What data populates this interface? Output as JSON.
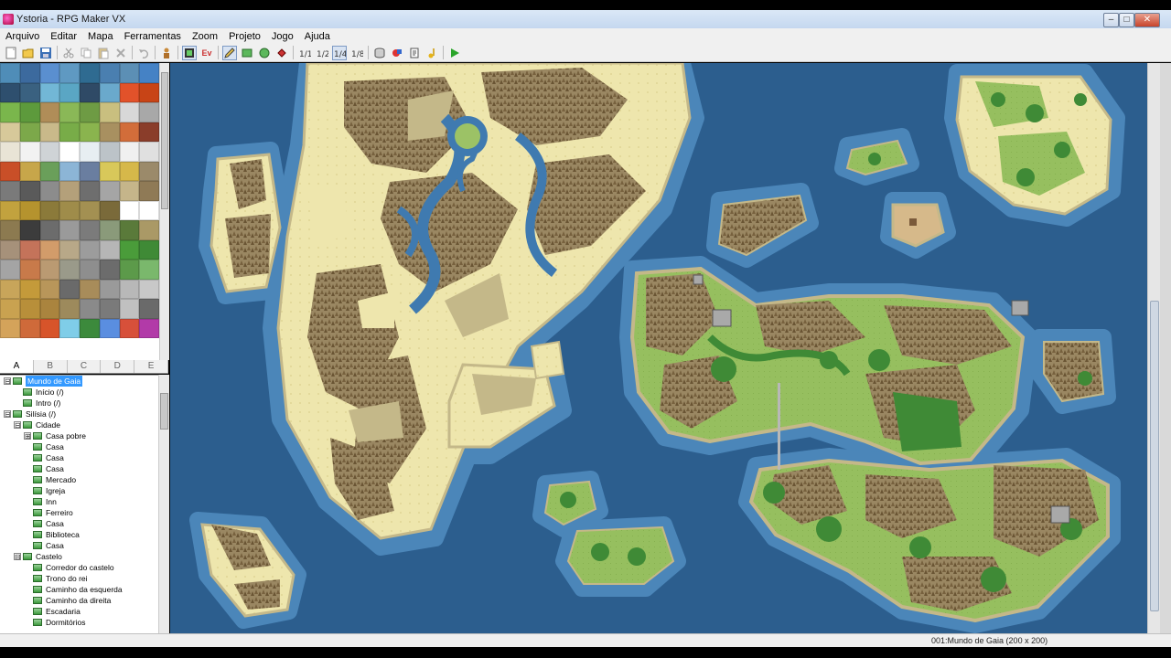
{
  "window": {
    "title": "Ystoria - RPG Maker VX",
    "minimize_label": "–",
    "maximize_label": "□",
    "close_label": "✕"
  },
  "menu": [
    "Arquivo",
    "Editar",
    "Mapa",
    "Ferramentas",
    "Zoom",
    "Projeto",
    "Jogo",
    "Ajuda"
  ],
  "toolbar": {
    "icons": [
      "new-project-icon",
      "open-project-icon",
      "save-icon",
      "cut-icon",
      "copy-icon",
      "paste-icon",
      "delete-icon",
      "undo-icon",
      "character-icon",
      "layer-map-icon",
      "layer-event-icon",
      "pencil-icon",
      "rectangle-icon",
      "ellipse-icon",
      "fill-icon",
      "zoom-1-1-icon",
      "zoom-1-2-icon",
      "zoom-1-4-icon",
      "zoom-1-8-icon",
      "database-icon",
      "material-icon",
      "script-editor-icon",
      "sound-test-icon",
      "playtest-icon"
    ],
    "event_layer_text": "Ev"
  },
  "tileset": {
    "tabs": [
      "A",
      "B",
      "C",
      "D",
      "E"
    ],
    "active_tab": "A",
    "tile_colors": [
      "#4f8db8",
      "#3c6a9e",
      "#5a8fd0",
      "#5f99c2",
      "#2f6b91",
      "#4a7fb0",
      "#5c8fb5",
      "#4582c5",
      "#2e4f6e",
      "#3a6180",
      "#72b7d6",
      "#5aa6c4",
      "#2f4a66",
      "#6aa9cc",
      "#e2522a",
      "#c84416",
      "#7ab64c",
      "#5d9a3c",
      "#b08d58",
      "#8ab857",
      "#6e9b44",
      "#c9bf7f",
      "#d8d8d8",
      "#a8a8a8",
      "#d7c99a",
      "#7ca84a",
      "#c9b98a",
      "#78ac48",
      "#8ab44e",
      "#a89060",
      "#d26d3a",
      "#8a3d2a",
      "#e9e4d6",
      "#f2f2f2",
      "#cfd3d6",
      "#ffffff",
      "#e7eef2",
      "#bcc3c8",
      "#f0f0f0",
      "#e0e0e0",
      "#c94f28",
      "#c7a64a",
      "#6a9f5a",
      "#8cb5d6",
      "#6a7ea0",
      "#d8c85a",
      "#d6b84a",
      "#9b8a6a",
      "#7a7a7a",
      "#5a5a5a",
      "#8c8c8c",
      "#b4a07a",
      "#6e6e6e",
      "#a5a5a5",
      "#c5b58a",
      "#8f7a56",
      "#c2a23e",
      "#b5932e",
      "#8b7a3a",
      "#9f8c4a",
      "#a39052",
      "#7a6a3a",
      "#ffffff",
      "#ffffff",
      "#8c7a50",
      "#3c3c3c",
      "#6c6c6c",
      "#9a9a9a",
      "#7b7b7b",
      "#8a9a7a",
      "#5a7a3a",
      "#aa9966",
      "#a6917a",
      "#c4735a",
      "#d29c6a",
      "#b8a888",
      "#9c9c9c",
      "#b6b6b6",
      "#4a9c3a",
      "#3f8a36",
      "#a4a4a4",
      "#c87a4a",
      "#ba9a72",
      "#9a9a8a",
      "#8e8e8e",
      "#6c6c6c",
      "#5c9a4a",
      "#7ab86c",
      "#c8a55a",
      "#c49a3a",
      "#b8965a",
      "#6a6a6a",
      "#a88c5a",
      "#9a9a9a",
      "#b8b8b8",
      "#c8c8c8",
      "#c9a250",
      "#b88f3a",
      "#aa843e",
      "#9d8a5c",
      "#8a8a8a",
      "#7a7a7a",
      "#c0c0c0",
      "#6a6a6a",
      "#d4a35a",
      "#cf6a3a",
      "#d7542a",
      "#7fcde8",
      "#3c8a3c",
      "#5a8ee0",
      "#d7503a",
      "#b23aa8"
    ]
  },
  "map_tree": [
    {
      "label": "Mundo de Gaia",
      "level": 0,
      "expander": "⊟",
      "selected": true
    },
    {
      "label": "Início (/)",
      "level": 1,
      "expander": "",
      "selected": false
    },
    {
      "label": "Intro (/)",
      "level": 1,
      "expander": "",
      "selected": false
    },
    {
      "label": "Silísia (/)",
      "level": 0,
      "expander": "⊟",
      "selected": false
    },
    {
      "label": "Cidade",
      "level": 1,
      "expander": "⊟",
      "selected": false
    },
    {
      "label": "Casa pobre",
      "level": 2,
      "expander": "⊞",
      "selected": false
    },
    {
      "label": "Casa",
      "level": 2,
      "expander": "",
      "selected": false
    },
    {
      "label": "Casa",
      "level": 2,
      "expander": "",
      "selected": false
    },
    {
      "label": "Casa",
      "level": 2,
      "expander": "",
      "selected": false
    },
    {
      "label": "Mercado",
      "level": 2,
      "expander": "",
      "selected": false
    },
    {
      "label": "Igreja",
      "level": 2,
      "expander": "",
      "selected": false
    },
    {
      "label": "Inn",
      "level": 2,
      "expander": "",
      "selected": false
    },
    {
      "label": "Ferreiro",
      "level": 2,
      "expander": "",
      "selected": false
    },
    {
      "label": "Casa",
      "level": 2,
      "expander": "",
      "selected": false
    },
    {
      "label": "Biblioteca",
      "level": 2,
      "expander": "",
      "selected": false
    },
    {
      "label": "Casa",
      "level": 2,
      "expander": "",
      "selected": false
    },
    {
      "label": "Castelo",
      "level": 1,
      "expander": "⊟",
      "selected": false
    },
    {
      "label": "Corredor do castelo",
      "level": 2,
      "expander": "",
      "selected": false
    },
    {
      "label": "Trono do rei",
      "level": 2,
      "expander": "",
      "selected": false
    },
    {
      "label": "Caminho da esquerda",
      "level": 2,
      "expander": "",
      "selected": false
    },
    {
      "label": "Caminho da direita",
      "level": 2,
      "expander": "",
      "selected": false
    },
    {
      "label": "Escadaria",
      "level": 2,
      "expander": "",
      "selected": false
    },
    {
      "label": "Dormitórios",
      "level": 2,
      "expander": "",
      "selected": false
    }
  ],
  "status": {
    "map_info": "001:Mundo de Gaia (200 x 200)"
  },
  "colors": {
    "ocean": "#2c5e8e",
    "shallow": "#3f7ab0",
    "sand": "#eee7b0",
    "sand_dark": "#c4b889",
    "grass": "#9cc266",
    "forest": "#3f8a36",
    "mountain": "#8a7553",
    "town_land": "#d6b98a"
  }
}
